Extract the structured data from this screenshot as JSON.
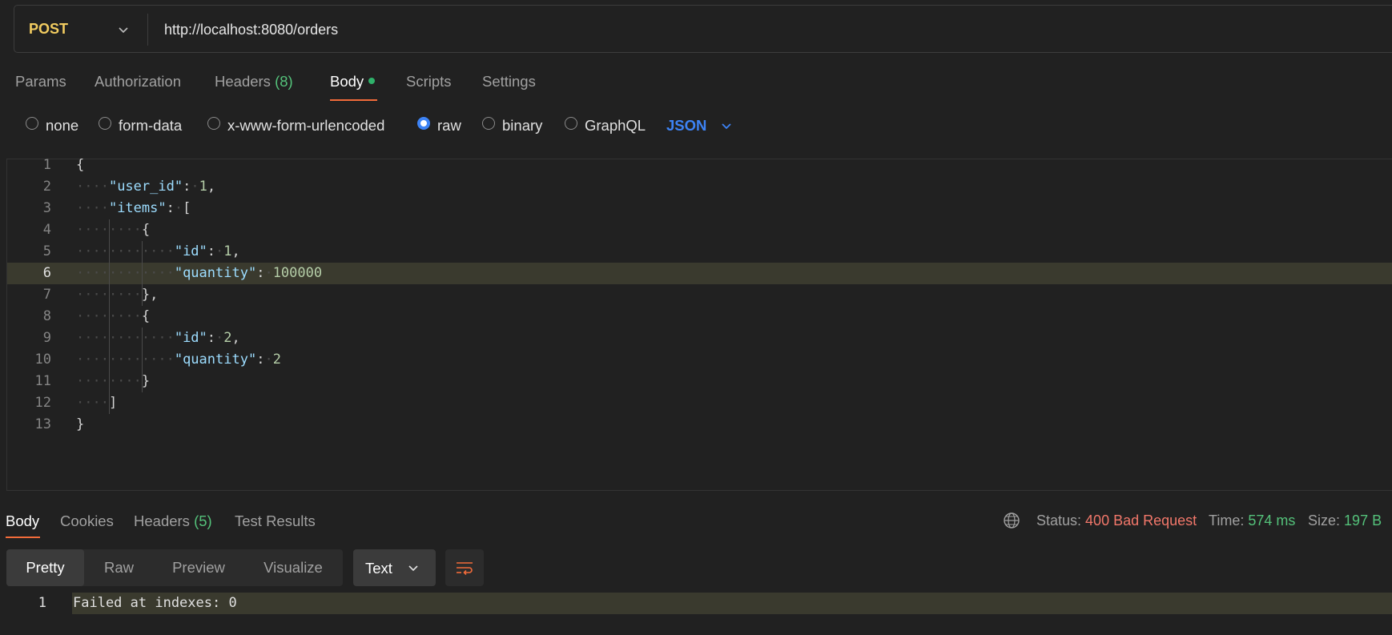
{
  "request": {
    "method": "POST",
    "url": "http://localhost:8080/orders"
  },
  "request_tabs": {
    "params": "Params",
    "authorization": "Authorization",
    "headers": "Headers",
    "headers_count": "(8)",
    "body": "Body",
    "scripts": "Scripts",
    "settings": "Settings"
  },
  "body_types": {
    "none": "none",
    "form_data": "form-data",
    "urlencoded": "x-www-form-urlencoded",
    "raw": "raw",
    "binary": "binary",
    "graphql": "GraphQL",
    "selected": "raw",
    "language": "JSON"
  },
  "editor": {
    "line_numbers": [
      "1",
      "2",
      "3",
      "4",
      "5",
      "6",
      "7",
      "8",
      "9",
      "10",
      "11",
      "12",
      "13"
    ],
    "lines": [
      {
        "indent": 0,
        "tokens": [
          [
            "p",
            "{"
          ]
        ]
      },
      {
        "indent": 1,
        "tokens": [
          [
            "k",
            "\"user_id\""
          ],
          [
            "p",
            ":"
          ],
          [
            "ws",
            "·"
          ],
          [
            "n",
            "1"
          ],
          [
            "p",
            ","
          ]
        ]
      },
      {
        "indent": 1,
        "tokens": [
          [
            "k",
            "\"items\""
          ],
          [
            "p",
            ":"
          ],
          [
            "ws",
            "·"
          ],
          [
            "p",
            "["
          ]
        ]
      },
      {
        "indent": 2,
        "tokens": [
          [
            "p",
            "{"
          ]
        ]
      },
      {
        "indent": 3,
        "tokens": [
          [
            "k",
            "\"id\""
          ],
          [
            "p",
            ":"
          ],
          [
            "ws",
            "·"
          ],
          [
            "n",
            "1"
          ],
          [
            "p",
            ","
          ]
        ]
      },
      {
        "indent": 3,
        "tokens": [
          [
            "k",
            "\"quantity\""
          ],
          [
            "p",
            ":"
          ],
          [
            "ws",
            "·"
          ],
          [
            "n",
            "100000"
          ]
        ]
      },
      {
        "indent": 2,
        "tokens": [
          [
            "p",
            "},"
          ]
        ]
      },
      {
        "indent": 2,
        "tokens": [
          [
            "p",
            "{"
          ]
        ]
      },
      {
        "indent": 3,
        "tokens": [
          [
            "k",
            "\"id\""
          ],
          [
            "p",
            ":"
          ],
          [
            "ws",
            "·"
          ],
          [
            "n",
            "2"
          ],
          [
            "p",
            ","
          ]
        ]
      },
      {
        "indent": 3,
        "tokens": [
          [
            "k",
            "\"quantity\""
          ],
          [
            "p",
            ":"
          ],
          [
            "ws",
            "·"
          ],
          [
            "n",
            "2"
          ]
        ]
      },
      {
        "indent": 2,
        "tokens": [
          [
            "p",
            "}"
          ]
        ]
      },
      {
        "indent": 1,
        "tokens": [
          [
            "p",
            "]"
          ]
        ]
      },
      {
        "indent": 0,
        "tokens": [
          [
            "p",
            "}"
          ]
        ]
      }
    ],
    "current_line": 6
  },
  "response_tabs": {
    "body": "Body",
    "cookies": "Cookies",
    "headers": "Headers",
    "headers_count": "(5)",
    "test_results": "Test Results"
  },
  "response_meta": {
    "status_label": "Status:",
    "status_value": "400 Bad Request",
    "time_label": "Time:",
    "time_value": "574 ms",
    "size_label": "Size:",
    "size_value": "197 B"
  },
  "response_view": {
    "pretty": "Pretty",
    "raw": "Raw",
    "preview": "Preview",
    "visualize": "Visualize",
    "format": "Text"
  },
  "response_body": {
    "line_number": "1",
    "text": "Failed at indexes: 0"
  },
  "colors": {
    "accent": "#f26b3a",
    "method": "#f2cc60",
    "link_blue": "#3d83f5",
    "success": "#54c17a",
    "error": "#f1776a"
  }
}
